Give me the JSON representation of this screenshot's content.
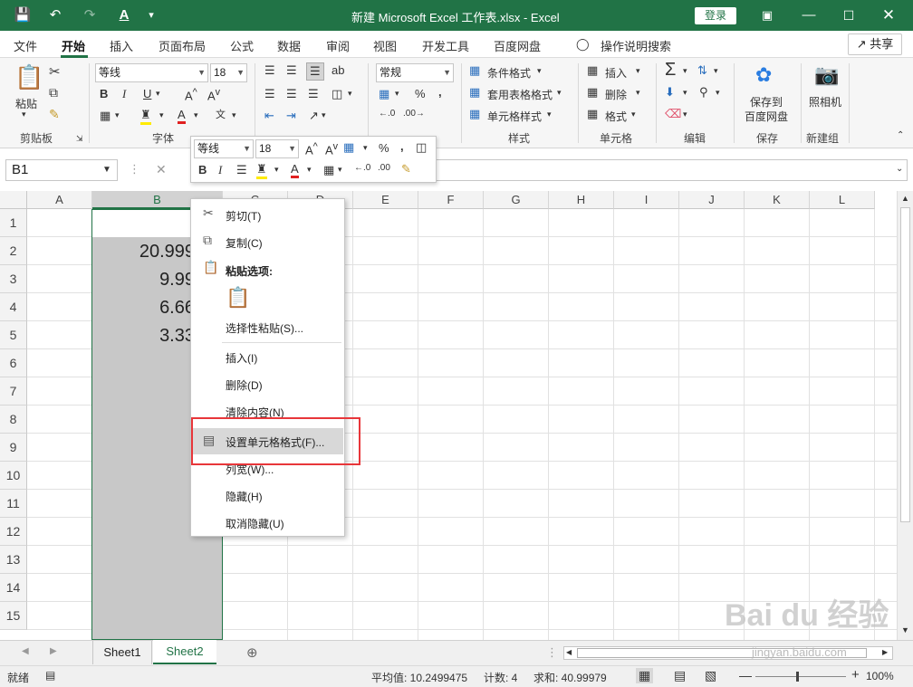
{
  "titlebar": {
    "title": "新建 Microsoft Excel 工作表.xlsx  -  Excel",
    "login": "登录"
  },
  "menu": {
    "items": [
      "文件",
      "开始",
      "插入",
      "页面布局",
      "公式",
      "数据",
      "审阅",
      "视图",
      "开发工具",
      "百度网盘"
    ],
    "search": "操作说明搜索",
    "share": "共享"
  },
  "ribbon": {
    "paste": "粘贴",
    "font_name": "等线",
    "font_size": "18",
    "wrap": "ab",
    "number_format": "常规",
    "conditional": "条件格式",
    "table_format": "套用表格格式",
    "cell_style": "单元格样式",
    "insert": "插入",
    "delete": "删除",
    "format": "格式",
    "save_baidu_1": "保存到",
    "save_baidu_2": "百度网盘",
    "camera": "照相机",
    "groups": {
      "clipboard": "剪贴板",
      "font": "字体",
      "style": "样式",
      "cells": "单元格",
      "editing": "编辑",
      "save": "保存",
      "newgroup": "新建组"
    }
  },
  "formula": {
    "namebox": "B1"
  },
  "grid": {
    "columns": [
      "A",
      "B",
      "C",
      "D",
      "E",
      "F",
      "G",
      "H",
      "I",
      "J",
      "K",
      "L"
    ],
    "rows": [
      "1",
      "2",
      "3",
      "4",
      "5",
      "6",
      "7",
      "8",
      "9",
      "10",
      "11",
      "12",
      "13",
      "14",
      "15"
    ],
    "values": [
      "20.999",
      "9.99",
      "6.66",
      "3.33"
    ]
  },
  "minitoolbar": {
    "font_name": "等线",
    "font_size": "18"
  },
  "context_menu": {
    "cut": "剪切(T)",
    "copy": "复制(C)",
    "paste_options": "粘贴选项:",
    "paste_special": "选择性粘贴(S)...",
    "insert": "插入(I)",
    "delete": "删除(D)",
    "clear": "清除内容(N)",
    "format_cells": "设置单元格格式(F)...",
    "col_width": "列宽(W)...",
    "hide": "隐藏(H)",
    "unhide": "取消隐藏(U)"
  },
  "sheets": [
    "Sheet1",
    "Sheet2"
  ],
  "status": {
    "ready": "就绪",
    "average": "平均值: 10.2499475",
    "count": "计数: 4",
    "sum": "求和: 40.99979",
    "zoom": "100%"
  },
  "watermark": {
    "logo": "Bai du 经验",
    "url": "jingyan.baidu.com"
  },
  "colors": {
    "excel_green": "#217346",
    "highlight_red": "#e8363a"
  }
}
